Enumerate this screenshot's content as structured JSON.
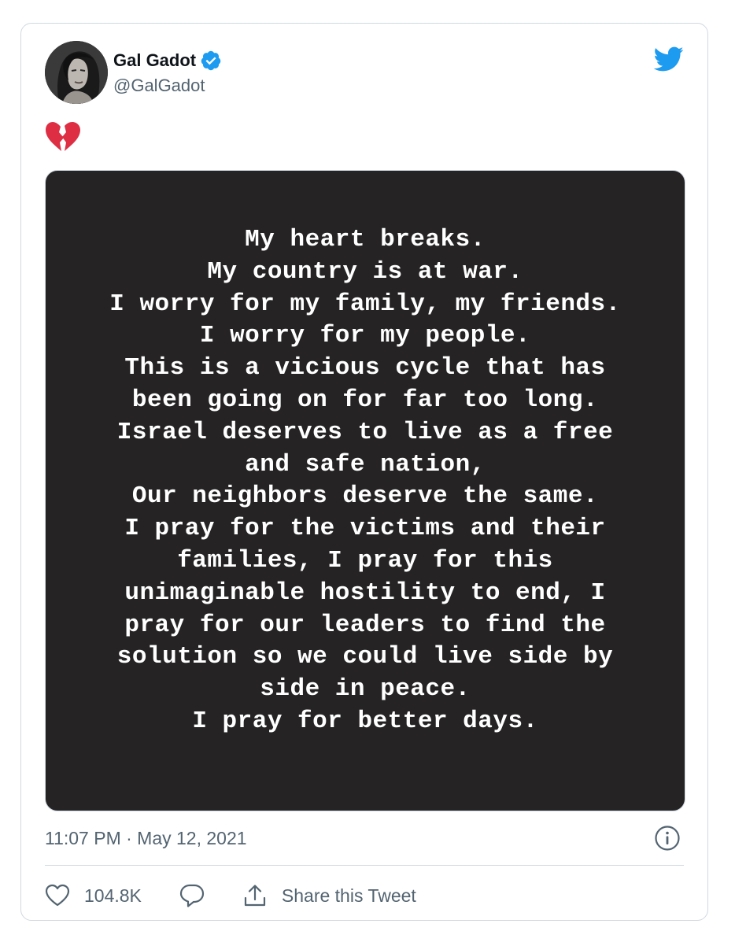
{
  "user": {
    "display_name": "Gal Gadot",
    "handle": "@GalGadot",
    "verified": true,
    "verified_icon": "verified-badge-icon",
    "avatar": "profile-photo"
  },
  "brand": {
    "icon": "twitter-bird-icon",
    "color": "#1d9bf0"
  },
  "tweet": {
    "emoji_icon": "broken-heart-icon",
    "emoji_color": "#dd2e44",
    "media": {
      "background": "#252324",
      "lines": [
        "My heart breaks.",
        "My country is at war.",
        "I worry for my family, my friends.",
        "I worry for my people.",
        "This is a vicious cycle that has",
        "been going on for far too long.",
        "Israel deserves to live as a free",
        "and safe nation,",
        "Our neighbors deserve the same.",
        "I pray for the victims and their",
        "families, I pray for this",
        "unimaginable hostility to end, I",
        "pray for our leaders to find the",
        "solution so we could live side by",
        "side in peace.",
        "I pray for better days."
      ]
    },
    "timestamp": "11:07 PM · May 12, 2021",
    "info_icon": "info-icon"
  },
  "actions": {
    "like_icon": "heart-icon",
    "like_count": "104.8K",
    "reply_icon": "reply-bubble-icon",
    "share_icon": "share-icon",
    "share_label": "Share this Tweet"
  }
}
